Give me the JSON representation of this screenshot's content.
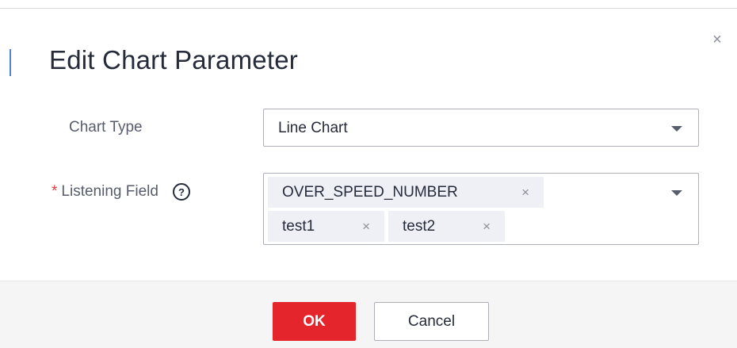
{
  "dialog": {
    "title": "Edit Chart Parameter",
    "close_icon": "close-icon",
    "close_glyph": "×"
  },
  "chart_type": {
    "label": "Chart Type",
    "value": "Line Chart"
  },
  "listening_field": {
    "required_mark": "*",
    "label": "Listening Field",
    "help_glyph": "?",
    "tags": [
      {
        "label": "OVER_SPEED_NUMBER",
        "remove": "×"
      },
      {
        "label": "test1",
        "remove": "×"
      },
      {
        "label": "test2",
        "remove": "×"
      }
    ]
  },
  "footer": {
    "ok_label": "OK",
    "cancel_label": "Cancel"
  },
  "colors": {
    "primary_button": "#e4252c",
    "required": "#e4393c",
    "accent_bar": "#4f86d9"
  }
}
